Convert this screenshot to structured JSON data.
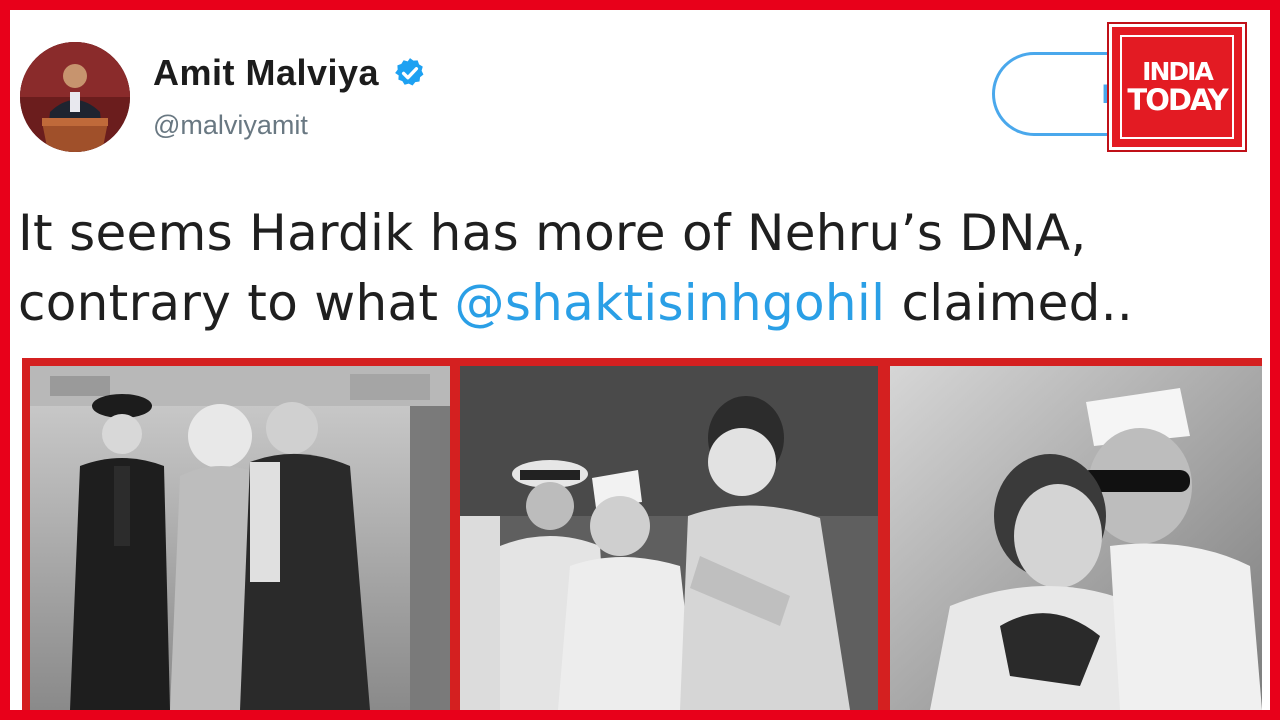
{
  "tweet": {
    "author": {
      "display_name": "Amit Malviya",
      "handle": "@malviyamit",
      "verified_icon": "verified-badge-icon"
    },
    "follow_label": "Fol",
    "text": {
      "part1": "It seems Hardik has more of Nehru’s DNA,",
      "part2": "contrary to what ",
      "mention": "@shaktisinhgohil",
      "part3": " claimed.."
    }
  },
  "branding": {
    "line1": "INDIA",
    "line2": "TODAY"
  },
  "colors": {
    "frame": "#e8001a",
    "mention": "#2a9fe6",
    "follow": "#4aa8ec",
    "logo": "#e31b23"
  }
}
